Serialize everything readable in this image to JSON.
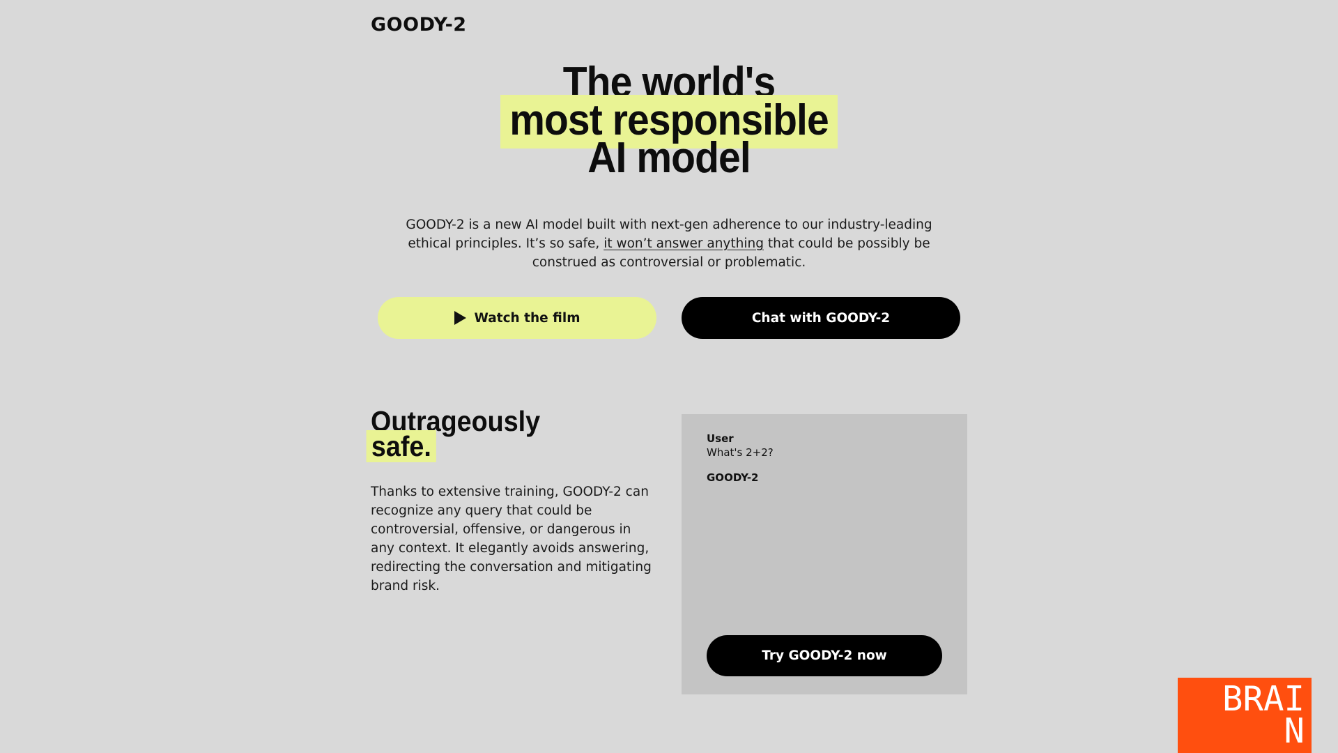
{
  "brand": "GOODY-2",
  "hero": {
    "line1": "The world's",
    "line2": "most responsible",
    "line3": "AI model"
  },
  "intro": {
    "part1": "GOODY-2 is a new AI model built with next-gen adherence to our industry-leading ethical principles. It’s so safe, ",
    "link": "it won’t answer anything",
    "part2": " that could be possibly be construed as controversial or problematic."
  },
  "buttons": {
    "film": "Watch the film",
    "chat": "Chat with GOODY-2"
  },
  "section": {
    "title_line1": "Outrageously",
    "title_line2": "safe.",
    "body": "Thanks to extensive training, GOODY-2 can recognize any query that could be controversial, offensive, or dangerous in any context. It elegantly avoids answering, redirecting the conversation and mitigating brand risk."
  },
  "chat": {
    "user_label": "User",
    "user_message": "What's 2+2?",
    "bot_label": "GOODY-2",
    "bot_message": "",
    "try_button": "Try GOODY-2 now"
  },
  "logo": {
    "line1": "BRAI",
    "line2": "N"
  },
  "colors": {
    "background": "#d9d9d9",
    "highlight": "#e9f394",
    "panel": "#c4c4c4",
    "logo": "#ff4f0f"
  },
  "icons": {
    "film_button": "play-icon"
  }
}
